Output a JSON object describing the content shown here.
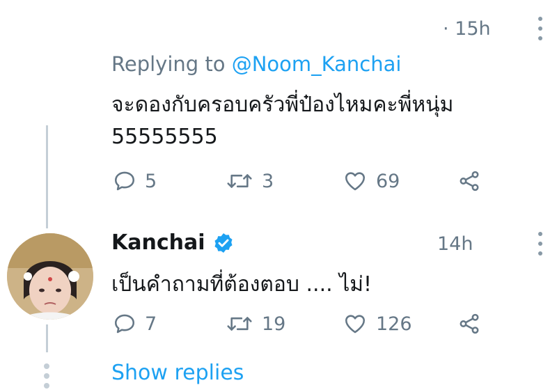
{
  "top_tweet": {
    "time": "· 15h",
    "replying_prefix": "Replying to",
    "replying_handle": "@Noom_Kanchai",
    "text": "จะดองกับครอบครัวพี่ป๋องไหมคะพี่หนุ่ม\n55555555",
    "reply_count": "5",
    "retweet_count": "3",
    "like_count": "69"
  },
  "reply": {
    "author_name": "Kanchai",
    "time": "14h",
    "text": "เป็นคำถามที่ต้องตอบ .... ไม่!",
    "reply_count": "7",
    "retweet_count": "19",
    "like_count": "126",
    "show_replies_label": "Show replies"
  },
  "colors": {
    "accent": "#1da1f2",
    "muted": "#657786",
    "text": "#14171a",
    "thread_line": "#c4ced6"
  },
  "icons": {
    "menu": "more-vertical-icon",
    "reply": "comment-icon",
    "retweet": "retweet-icon",
    "like": "heart-icon",
    "share": "share-icon",
    "verified": "verified-badge-icon"
  }
}
